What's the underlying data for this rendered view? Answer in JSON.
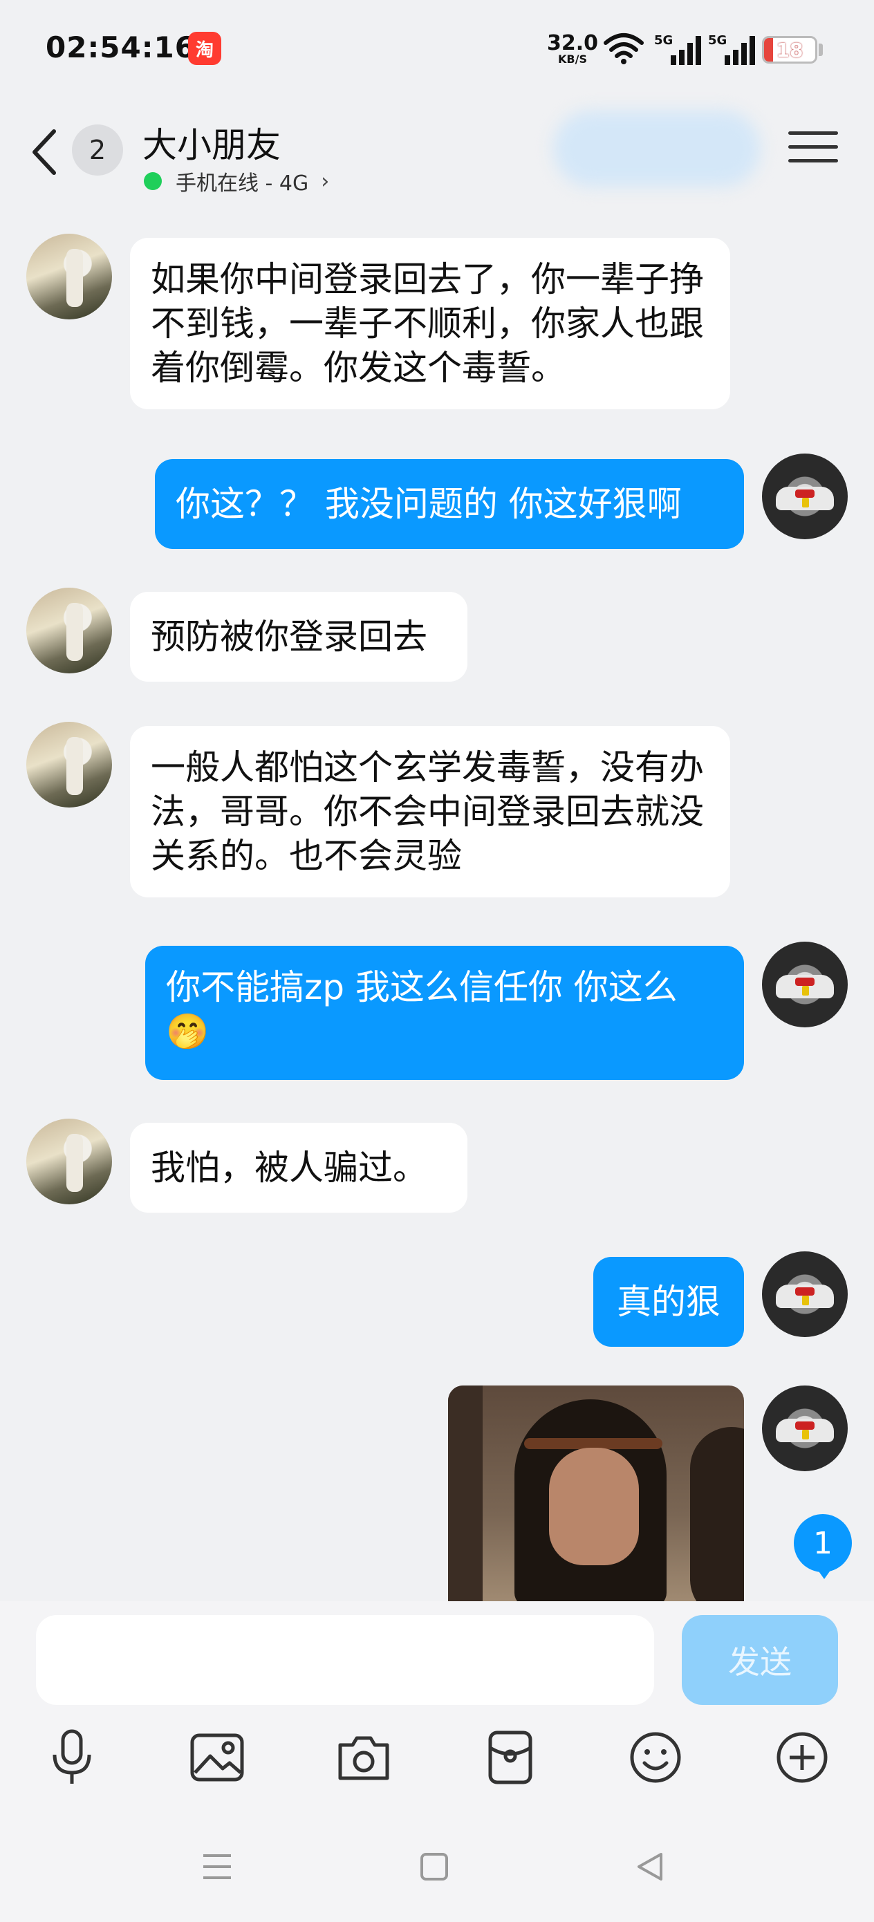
{
  "status_bar": {
    "time": "02:54:16",
    "taobao_glyph": "淘",
    "net_speed_value": "32.0",
    "net_speed_unit": "KB/S",
    "sim1_label": "5G",
    "sim2_label": "5G",
    "battery_level": "18",
    "battery_color": "#e6453d"
  },
  "header": {
    "unread_count": "2",
    "title": "大小朋友",
    "online_status": "手机在线 - 4G",
    "online_color": "#1fcf5a"
  },
  "messages": [
    {
      "sender": "them",
      "text": "如果你中间登录回去了，你一辈子挣不到钱，一辈子不顺利，你家人也跟着你倒霉。你发这个毒誓。"
    },
    {
      "sender": "me",
      "text": "你这？？ 我没问题的 你这好狠啊"
    },
    {
      "sender": "them",
      "text": "预防被你登录回去"
    },
    {
      "sender": "them",
      "text": "一般人都怕这个玄学发毒誓，没有办法，哥哥。你不会中间登录回去就没关系的。也不会灵验"
    },
    {
      "sender": "me",
      "text": "你不能搞zp 我这么信任你 你这么",
      "emoji": "🤭"
    },
    {
      "sender": "them",
      "text": "我怕，被人骗过。"
    },
    {
      "sender": "me",
      "text": "真的狠"
    },
    {
      "sender": "me",
      "type": "image"
    }
  ],
  "new_message_badge": "1",
  "composer": {
    "input_value": "",
    "send_label": "发送"
  },
  "toolbar_icons": [
    "mic-icon",
    "image-icon",
    "camera-icon",
    "red-packet-icon",
    "emoji-icon",
    "plus-icon"
  ],
  "nav_icons": [
    "menu-key-icon",
    "home-key-icon",
    "back-key-icon"
  ],
  "colors": {
    "accent": "#0a99ff",
    "background": "#f0f1f3",
    "incoming_bubble": "#ffffff"
  }
}
